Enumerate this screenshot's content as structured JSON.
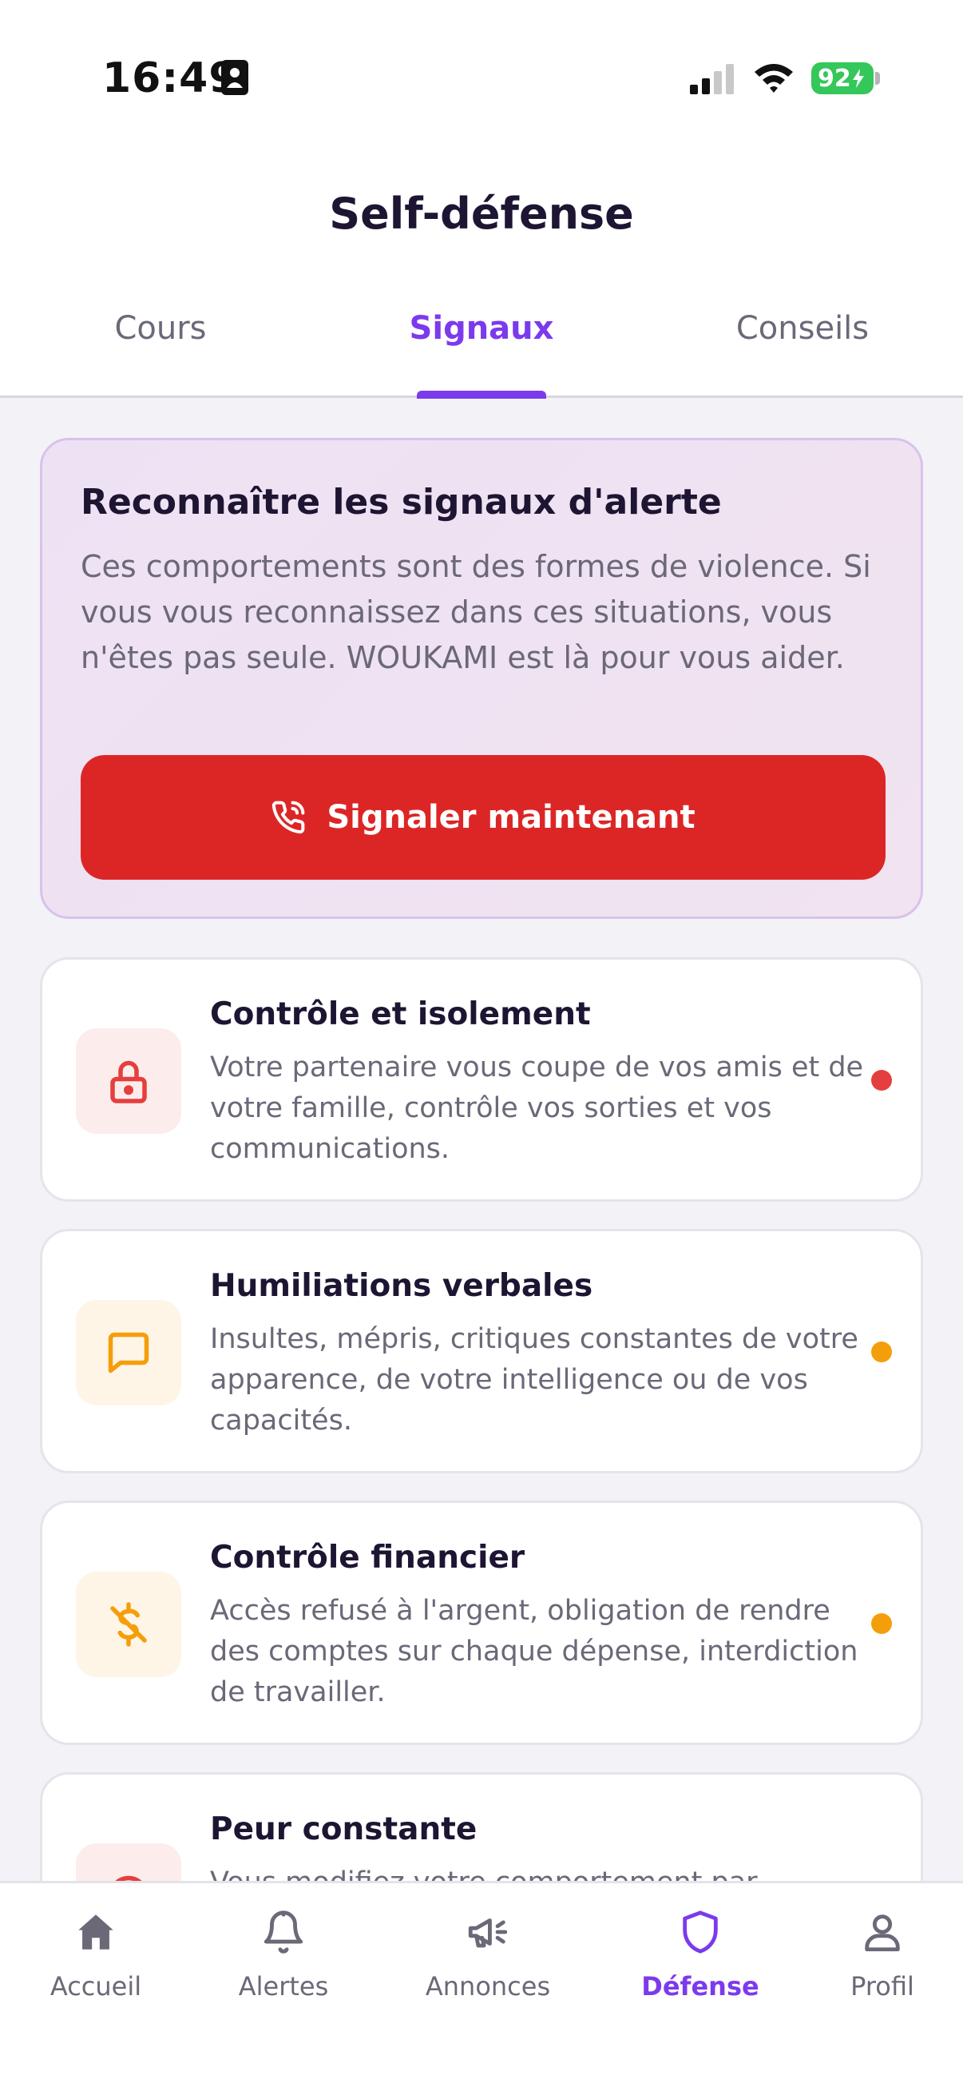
{
  "status_bar": {
    "time": "16:49",
    "battery": "92"
  },
  "header": {
    "title": "Self-défense",
    "tabs": [
      {
        "label": "Cours"
      },
      {
        "label": "Signaux"
      },
      {
        "label": "Conseils"
      }
    ],
    "active_tab": "Signaux"
  },
  "alert_card": {
    "title": "Reconnaître les signaux d'alerte",
    "text": "Ces comportements sont des formes de violence. Si vous vous reconnaissez dans ces situations, vous n'êtes pas seule. WOUKAMI est là pour vous aider.",
    "button_label": "Signaler maintenant",
    "button_icon": "phone-call-icon"
  },
  "signals": [
    {
      "title": "Contrôle et isolement",
      "text": "Votre partenaire vous coupe de vos amis et de votre famille, contrôle vos sorties et vos communications.",
      "icon": "lock-icon",
      "icon_color": "#e53e3e",
      "icon_bg": "#fdecec",
      "severity_color": "#e53e3e"
    },
    {
      "title": "Humiliations verbales",
      "text": "Insultes, mépris, critiques constantes de votre apparence, de votre intelligence ou de vos capacités.",
      "icon": "message-square-icon",
      "icon_color": "#f59e0b",
      "icon_bg": "#fef5e7",
      "severity_color": "#f59e0b"
    },
    {
      "title": "Contrôle financier",
      "text": "Accès refusé à l'argent, obligation de rendre des comptes sur chaque dépense, interdiction de travailler.",
      "icon": "dollar-off-icon",
      "icon_color": "#f59e0b",
      "icon_bg": "#fef5e7",
      "severity_color": "#f59e0b"
    },
    {
      "title": "Peur constante",
      "text": "Vous modifiez votre comportement par",
      "icon": "alert-circle-icon",
      "icon_color": "#e53e3e",
      "icon_bg": "#fdecec",
      "severity_color": "#e53e3e"
    }
  ],
  "bottom_nav": [
    {
      "label": "Accueil",
      "icon": "home-icon"
    },
    {
      "label": "Alertes",
      "icon": "bell-icon"
    },
    {
      "label": "Annonces",
      "icon": "megaphone-icon"
    },
    {
      "label": "Défense",
      "icon": "shield-icon"
    },
    {
      "label": "Profil",
      "icon": "user-icon"
    }
  ],
  "colors": {
    "accent": "#7c3aed",
    "danger": "#dc2626",
    "text_primary": "#1e1533",
    "text_secondary": "#6b6878"
  }
}
